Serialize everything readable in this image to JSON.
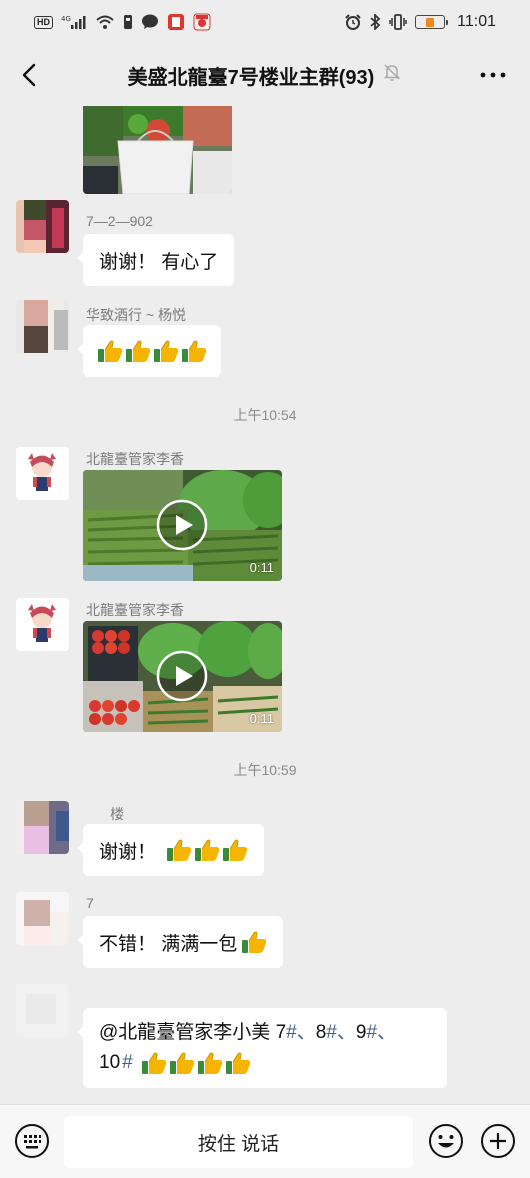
{
  "status_bar": {
    "left_badges": [
      "HD",
      "4G"
    ],
    "time": "11:01",
    "battery_level": 0.3,
    "battery_color": "#f08a1c",
    "icons": [
      "hd-icon",
      "signal-icon",
      "wifi-icon",
      "sim-icon",
      "message-icon",
      "red-app-icon",
      "game-app-icon",
      "alarm-icon",
      "bluetooth-icon",
      "vibrate-icon",
      "battery-icon"
    ]
  },
  "header": {
    "title": "美盛北龍臺7号楼业主群(93)",
    "icons": [
      "back-icon",
      "mute-bell-icon",
      "more-icon"
    ]
  },
  "messages": [
    {
      "type": "image",
      "sender": "",
      "description": "cropped photo"
    },
    {
      "type": "text",
      "sender": "7—2—902",
      "text": "谢谢！ 有心了"
    },
    {
      "type": "emoji",
      "sender": "华致酒行 ~ 杨悦",
      "emoji_count": 4
    },
    {
      "type": "time",
      "text": "上午10:54"
    },
    {
      "type": "video",
      "sender": "北龍臺管家李香",
      "duration": "0:11"
    },
    {
      "type": "video",
      "sender": "北龍臺管家李香",
      "duration": "0:11"
    },
    {
      "type": "time",
      "text": "上午10:59"
    },
    {
      "type": "text",
      "sender": "楼",
      "text": "谢谢！",
      "emoji_count": 3
    },
    {
      "type": "text",
      "sender": "7",
      "text": "不错！ 满满一包",
      "emoji_count": 1
    },
    {
      "type": "text",
      "sender": "",
      "line1_prefix": "@北龍臺管家李小美 7",
      "h1": "#、",
      "n8": "8",
      "h2": "#、",
      "n9": "9",
      "h3": "#、",
      "line2_prefix": "10",
      "h4": "#",
      "emoji_count": 4
    }
  ],
  "input_bar": {
    "hold_to_talk": "按住 说话",
    "icons": [
      "keyboard-icon",
      "emoji-face-icon",
      "plus-icon"
    ]
  },
  "colors": {
    "background": "#ededed",
    "bubble": "#ffffff",
    "accent_link": "#3f5d8a"
  }
}
